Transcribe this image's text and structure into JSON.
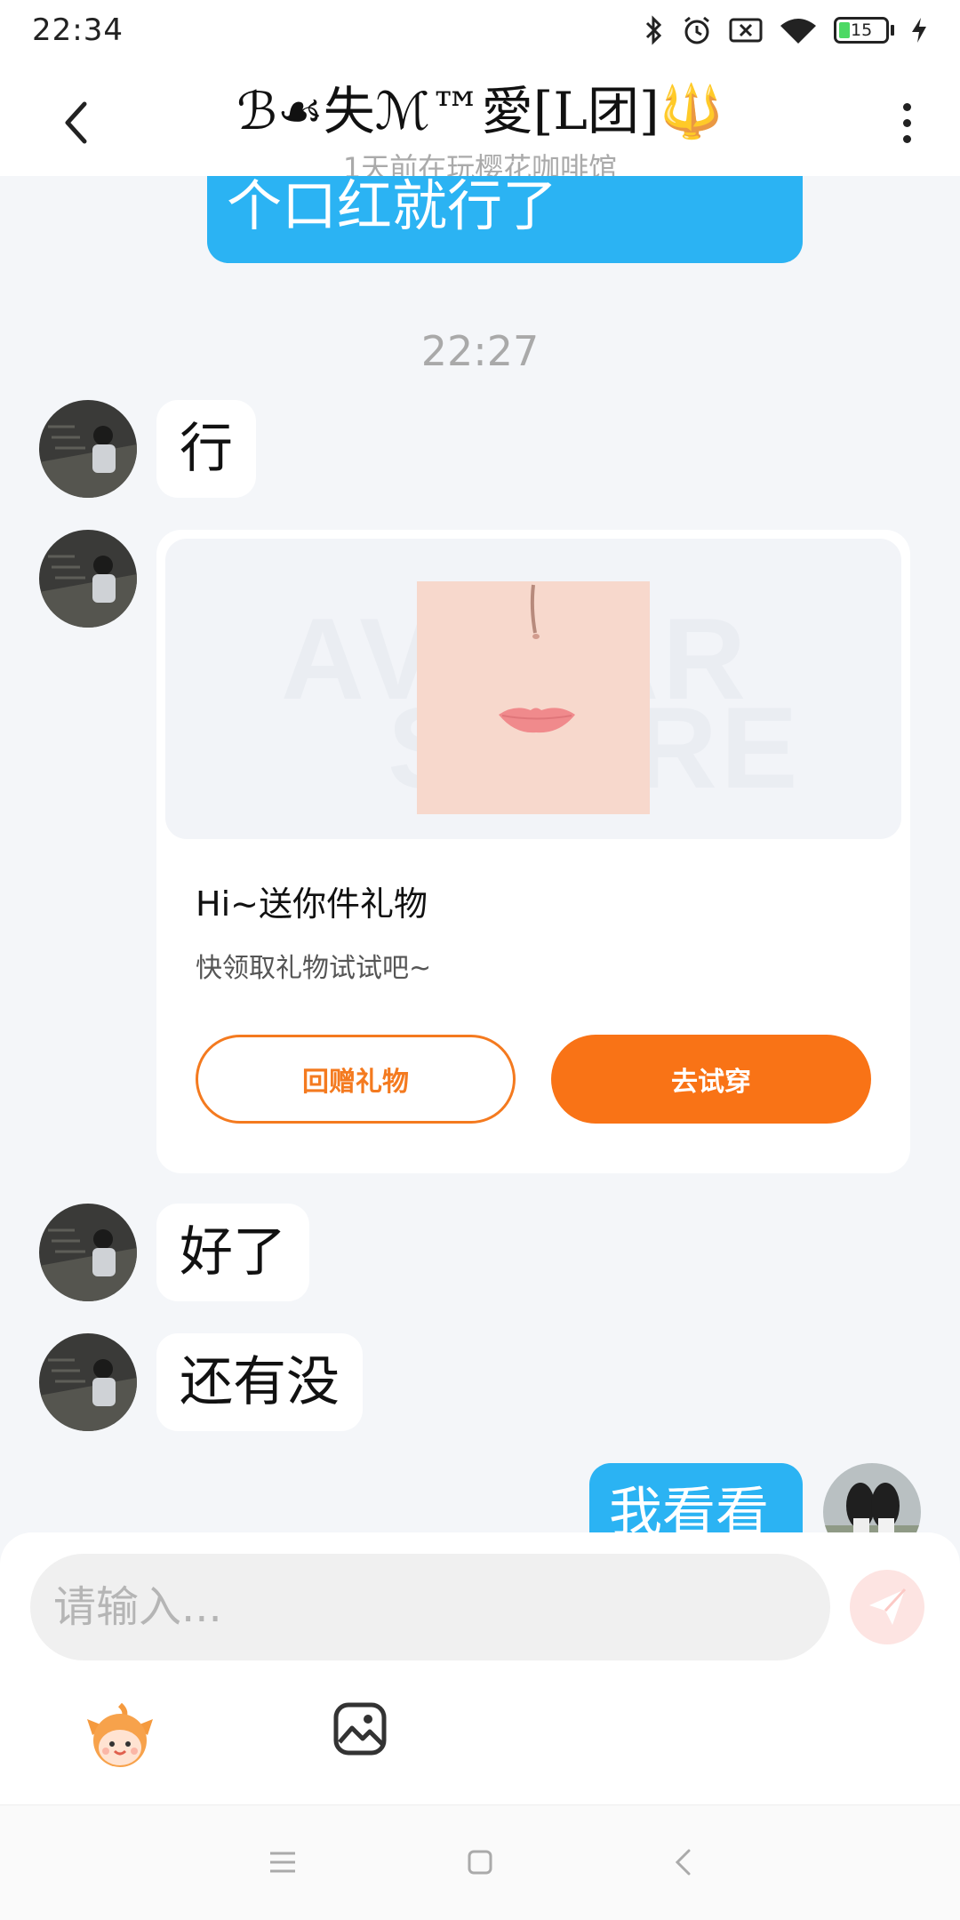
{
  "status_bar": {
    "time": "22:34",
    "battery_level": "15"
  },
  "header": {
    "title": "ℬ☙失ℳ™愛[L团]🔱",
    "subtitle": "1天前在玩樱花咖啡馆"
  },
  "messages": {
    "out_1": "个口红就行了",
    "timestamp": "22:27",
    "in_1": "行",
    "gift_card": {
      "watermark_top": "AVATAR",
      "watermark_bottom": "STORE",
      "title": "Hi~送你件礼物",
      "description": "快领取礼物试试吧~",
      "return_gift_label": "回赠礼物",
      "try_on_label": "去试穿"
    },
    "in_2": "好了",
    "in_3": "还有没",
    "out_2": "我看看"
  },
  "composer": {
    "placeholder": "请输入..."
  },
  "colors": {
    "accent_blue": "#2bb3f3",
    "accent_orange": "#f97316"
  },
  "icons": [
    "back-arrow-icon",
    "more-vertical-icon",
    "send-icon",
    "emoji-mascot-icon",
    "image-icon",
    "menu-icon",
    "home-icon",
    "back-icon"
  ]
}
